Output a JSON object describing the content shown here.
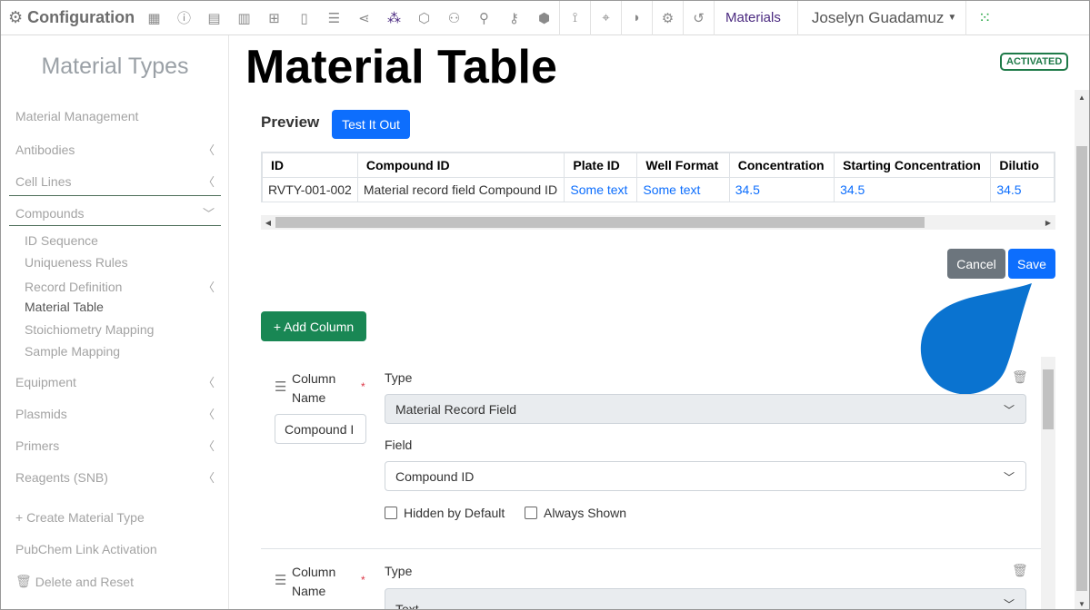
{
  "nav": {
    "brand": "Configuration",
    "icons": [
      "calculator-icon",
      "info-icon",
      "table-icon",
      "notebook-icon",
      "grid-icon",
      "document-icon",
      "database-icon",
      "share-icon",
      "molecule-icon",
      "shield-icon",
      "users-icon",
      "user-icon",
      "key-icon",
      "cube-icon",
      "workflow-icon",
      "location-icon",
      "ms-icon",
      "gears-icon",
      "history-icon"
    ],
    "section": "Materials",
    "user": "Joselyn Guadamuz"
  },
  "sidebar": {
    "title": "Material Types",
    "items": [
      {
        "label": "Material Management"
      },
      {
        "label": "Antibodies"
      },
      {
        "label": "Cell Lines"
      },
      {
        "label": "Compounds"
      },
      {
        "label": "Equipment"
      },
      {
        "label": "Plasmids"
      },
      {
        "label": "Primers"
      },
      {
        "label": "Reagents (SNB)"
      }
    ],
    "subitems": [
      "ID Sequence",
      "Uniqueness Rules",
      "Record Definition",
      "Material Table",
      "Stoichiometry Mapping",
      "Sample Mapping"
    ],
    "actions": [
      "+ Create Material Type",
      "PubChem Link Activation",
      "Delete and Reset"
    ]
  },
  "main": {
    "title": "Material Table",
    "badge": "ACTIVATED",
    "preview_label": "Preview",
    "test_button": "Test It Out",
    "table": {
      "headers": [
        "ID",
        "Compound ID",
        "Plate ID",
        "Well Format",
        "Concentration",
        "Starting Concentration",
        "Dilutio"
      ],
      "row": [
        "RVTY-001-002",
        "Material record field Compound ID",
        "Some text",
        "Some text",
        "34.5",
        "34.5",
        "34.5"
      ]
    },
    "cancel_button": "Cancel",
    "save_button": "Save",
    "add_column_button": "+ Add Column",
    "columns": [
      {
        "name_label": "Column Name",
        "required": "*",
        "name_value": "Compound I",
        "type_label": "Type",
        "type_value": "Material Record Field",
        "field_label": "Field",
        "field_value": "Compound ID",
        "hidden_label": "Hidden by Default",
        "always_label": "Always Shown"
      },
      {
        "name_label": "Column Name",
        "required": "*",
        "type_label": "Type",
        "type_value": "Text"
      }
    ]
  },
  "colors": {
    "accent": "#0d6efd",
    "success": "#198754",
    "brand": "#4b2a80",
    "drop": "#0a73d0"
  }
}
